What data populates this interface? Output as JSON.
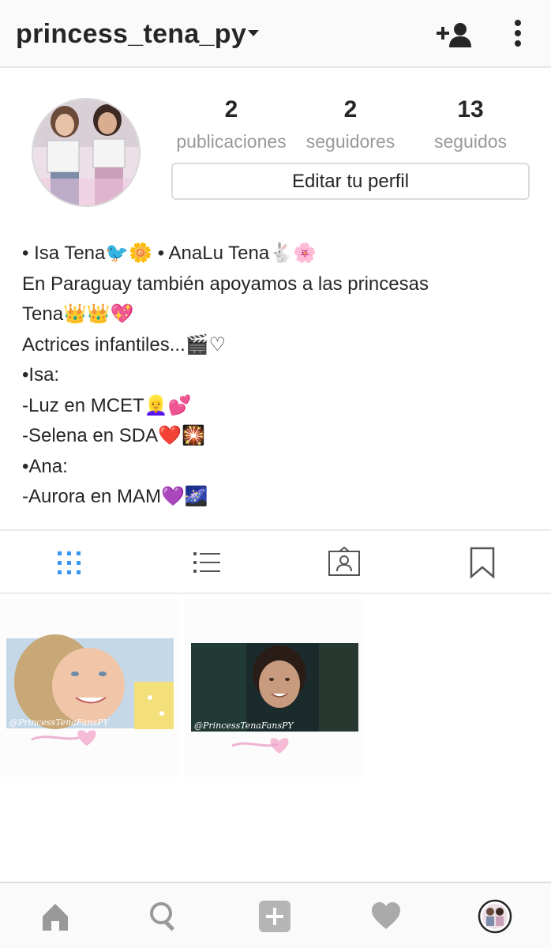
{
  "header": {
    "username": "princess_tena_py",
    "icons": [
      "chevron-down-icon",
      "add-user-icon",
      "more-vertical-icon"
    ]
  },
  "profile": {
    "stats": [
      {
        "value": "2",
        "label": "publicaciones"
      },
      {
        "value": "2",
        "label": "seguidores"
      },
      {
        "value": "13",
        "label": "seguidos"
      }
    ],
    "edit_button": "Editar tu perfil",
    "bio_lines": [
      "• Isa Tena🐦🌼 • AnaLu Tena🐇🌸",
      "En Paraguay también apoyamos a las princesas",
      "Tena👑👑💖",
      "Actrices infantiles...🎬♡",
      "•Isa:",
      "-Luz en MCET👱‍♀️💕",
      "-Selena en SDA❤️🎇",
      "•Ana:",
      "-Aurora en MAM💜🌌"
    ]
  },
  "tabs": [
    {
      "name": "grid-icon",
      "active": true
    },
    {
      "name": "list-icon",
      "active": false
    },
    {
      "name": "tagged-icon",
      "active": false
    },
    {
      "name": "saved-icon",
      "active": false
    }
  ],
  "posts": [
    {
      "name": "post-1",
      "watermark": "@PrincessTenaFansPY"
    },
    {
      "name": "post-2",
      "watermark": "@PrincessTenaFansPY"
    }
  ],
  "bottom_nav": [
    "home-icon",
    "search-icon",
    "add-post-icon",
    "activity-heart-icon",
    "profile-avatar-icon"
  ],
  "colors": {
    "active_tab": "#3897f0",
    "text": "#262626",
    "muted": "#999999",
    "icon": "#262626"
  }
}
